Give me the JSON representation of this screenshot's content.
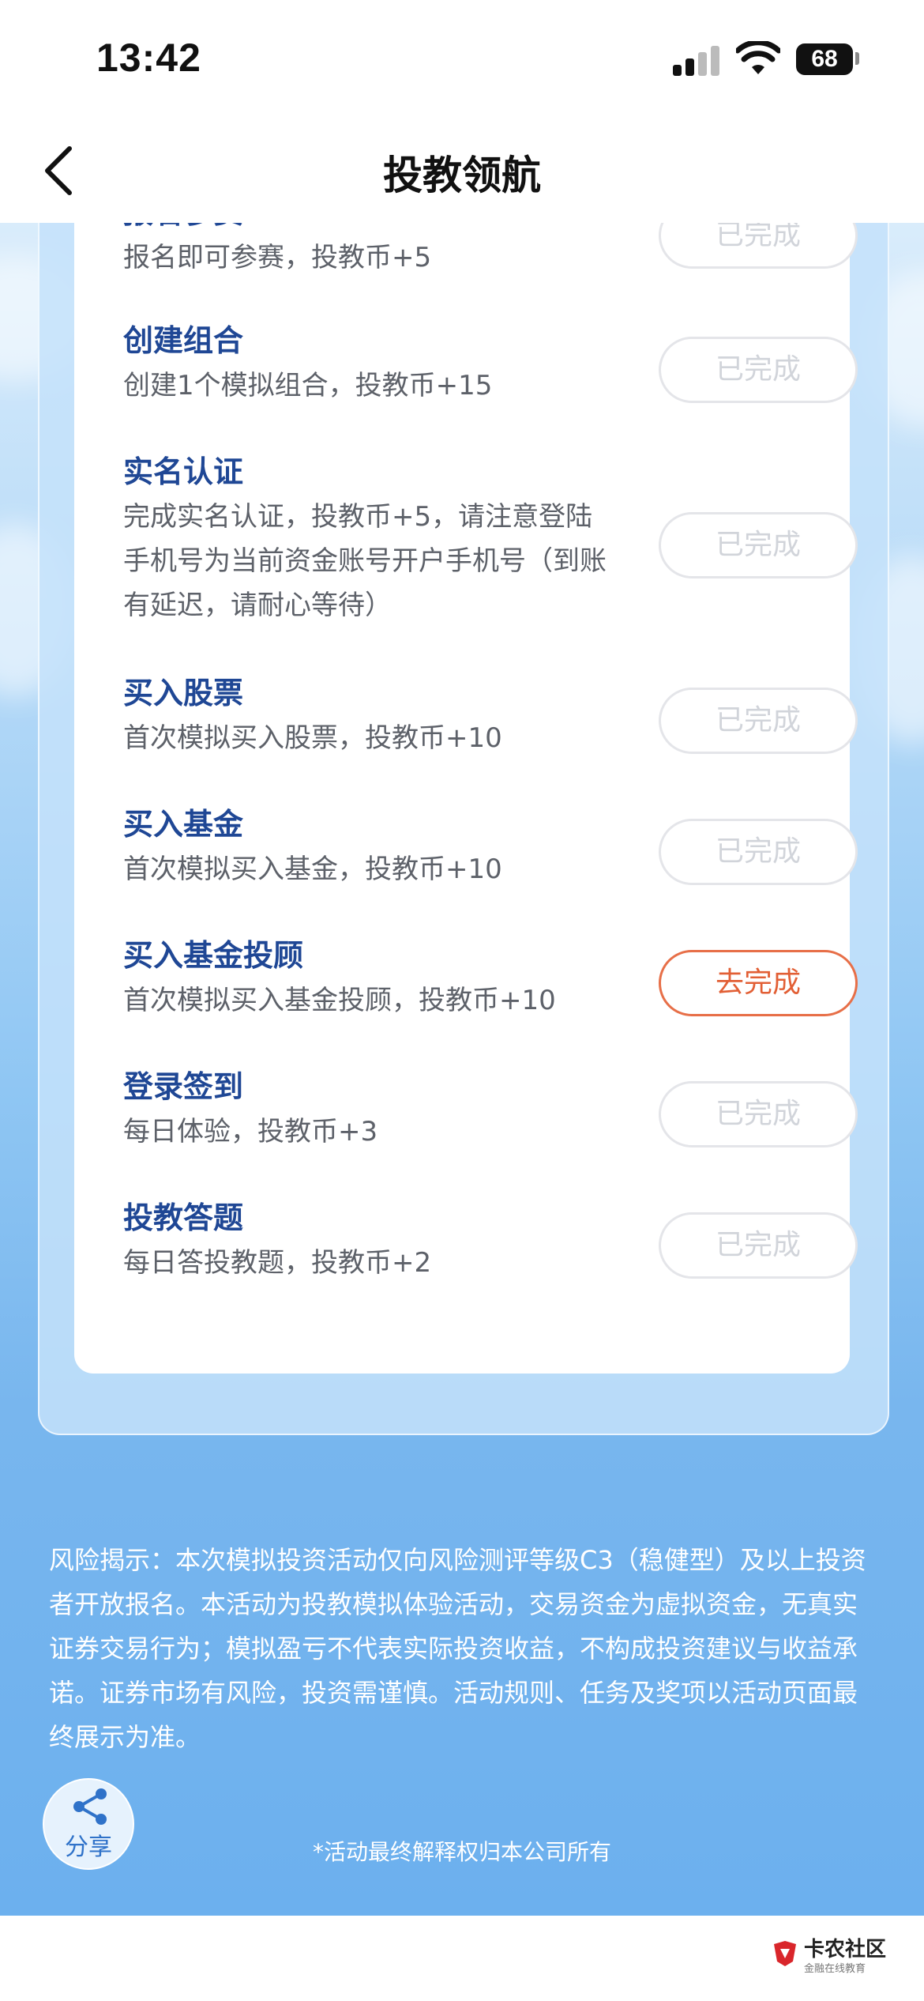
{
  "status_bar": {
    "time": "13:42",
    "battery": "68"
  },
  "nav": {
    "title": "投教领航"
  },
  "tasks": [
    {
      "title": "报名参赛",
      "desc": "报名即可参赛，投教币+5",
      "button": "已完成",
      "state": "done"
    },
    {
      "title": "创建组合",
      "desc": "创建1个模拟组合，投教币+15",
      "button": "已完成",
      "state": "done"
    },
    {
      "title": "实名认证",
      "desc": "完成实名认证，投教币+5，请注意登陆手机号为当前资金账号开户手机号（到账有延迟，请耐心等待）",
      "button": "已完成",
      "state": "done"
    },
    {
      "title": "买入股票",
      "desc": "首次模拟买入股票，投教币+10",
      "button": "已完成",
      "state": "done"
    },
    {
      "title": "买入基金",
      "desc": "首次模拟买入基金，投教币+10",
      "button": "已完成",
      "state": "done"
    },
    {
      "title": "买入基金投顾",
      "desc": "首次模拟买入基金投顾，投教币+10",
      "button": "去完成",
      "state": "todo"
    },
    {
      "title": "登录签到",
      "desc": "每日体验，投教币+3",
      "button": "已完成",
      "state": "done"
    },
    {
      "title": "投教答题",
      "desc": "每日答投教题，投教币+2",
      "button": "已完成",
      "state": "done"
    }
  ],
  "risk_notice": "风险揭示：本次模拟投资活动仅向风险测评等级C3（稳健型）及以上投资者开放报名。本活动为投教模拟体验活动，交易资金为虚拟资金，无真实证券交易行为；模拟盈亏不代表实际投资收益，不构成投资建议与收益承诺。证券市场有风险，投资需谨慎。活动规则、任务及奖项以活动页面最终展示为准。",
  "share": {
    "label": "分享"
  },
  "footer_note": "*活动最终解释权归本公司所有",
  "watermark": {
    "title": "卡农社区",
    "subtitle": "金融在线教育"
  },
  "colors": {
    "title_blue": "#1f4795",
    "accent_orange": "#e25f35",
    "bg_blue": "#7ab8ee"
  }
}
